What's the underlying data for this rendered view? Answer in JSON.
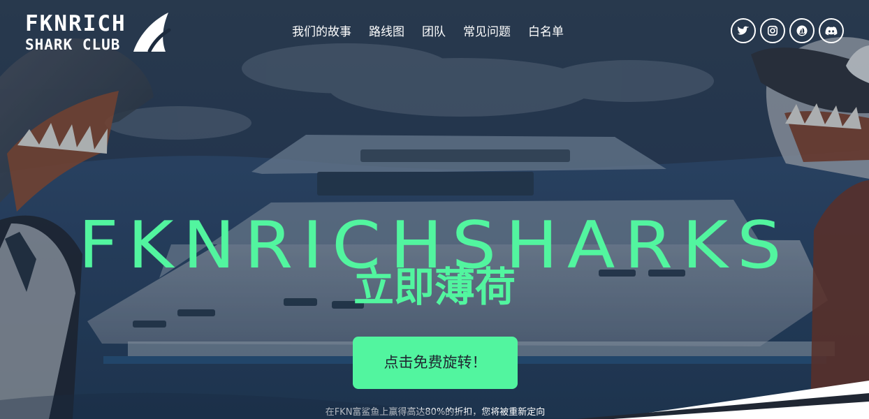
{
  "brand": {
    "line1": "FKNRICH",
    "line2": "SHARK CLUB"
  },
  "nav": [
    "我们的故事",
    "路线图",
    "团队",
    "常见问题",
    "白名单"
  ],
  "socials": [
    "twitter-icon",
    "instagram-icon",
    "opensea-icon",
    "discord-icon"
  ],
  "hero": {
    "title": "FKNRICHSHARKS",
    "subtitle": "立即薄荷",
    "button_label": "点击免费旋转！",
    "note": "在FKN富鲨鱼上赢得高达80%的折扣，您将被重新定向"
  },
  "colors": {
    "accent": "#52f59f",
    "background": "#1c2a3d",
    "text": "#ffffff"
  }
}
